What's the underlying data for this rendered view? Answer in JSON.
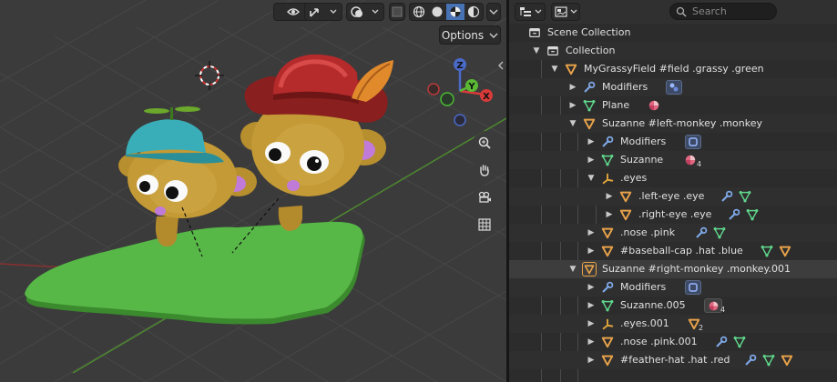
{
  "viewport": {
    "options_label": "Options",
    "gizmo_axes": [
      "X",
      "Y",
      "Z"
    ]
  },
  "outliner": {
    "search_placeholder": "Search",
    "scene_collection": "Scene Collection",
    "collection": "Collection",
    "field": {
      "label": "MyGrassyField #field .grassy .green",
      "modifiers": "Modifiers",
      "plane": "Plane"
    },
    "left_monkey": {
      "label": "Suzanne #left-monkey .monkey",
      "modifiers": "Modifiers",
      "mesh": "Suzanne",
      "mesh_users": "4",
      "eyes": ".eyes",
      "left_eye": ".left-eye .eye",
      "right_eye": ".right-eye .eye",
      "nose": ".nose .pink",
      "cap": "#baseball-cap .hat .blue"
    },
    "right_monkey": {
      "label": "Suzanne #right-monkey .monkey.001",
      "modifiers": "Modifiers",
      "mesh": "Suzanne.005",
      "mesh_users": "4",
      "eyes": ".eyes.001",
      "eyes_count": "2",
      "nose": ".nose .pink.001",
      "hat": "#feather-hat .hat .red"
    }
  },
  "colors": {
    "object_orange": "#e8a24a",
    "mesh_green": "#5fd88c",
    "modifier_blue": "#7fa8e8",
    "empty_orange": "#e0a43c",
    "material_pink": "#e06680",
    "selection_blue": "#4772b3"
  },
  "icons": {
    "outliner_display_mode": "outliner-icon",
    "filter": "filter-icon",
    "object": "triangle-object-icon",
    "mesh": "mesh-icon",
    "modifier": "wrench-icon",
    "empty": "empty-axes-icon",
    "material": "material-icon",
    "collection": "collection-box-icon"
  }
}
